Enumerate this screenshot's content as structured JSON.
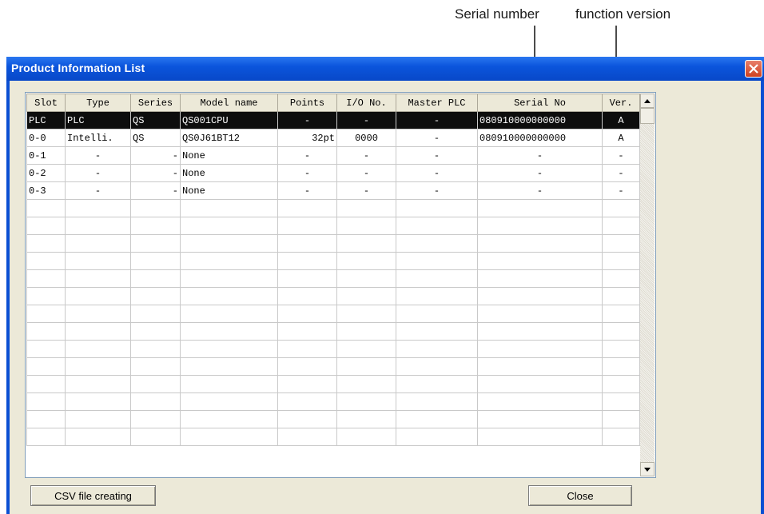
{
  "annotations": {
    "serial": "Serial number",
    "version": "function version"
  },
  "window": {
    "title": "Product Information List",
    "close_glyph": "close-icon"
  },
  "table": {
    "headers": [
      "Slot",
      "Type",
      "Series",
      "Model name",
      "Points",
      "I/O No.",
      "Master PLC",
      "Serial No",
      "Ver."
    ],
    "rows": [
      [
        "PLC",
        "PLC",
        "QS",
        "QS001CPU",
        "-",
        "-",
        "-",
        "080910000000000",
        "A"
      ],
      [
        "0-0",
        "Intelli.",
        "QS",
        "QS0J61BT12",
        "32pt",
        "0000",
        "-",
        "080910000000000",
        "A"
      ],
      [
        "0-1",
        "-",
        "-",
        "None",
        "-",
        "-",
        "-",
        "-",
        "-"
      ],
      [
        "0-2",
        "-",
        "-",
        "None",
        "-",
        "-",
        "-",
        "-",
        "-"
      ],
      [
        "0-3",
        "-",
        "-",
        "None",
        "-",
        "-",
        "-",
        "-",
        "-"
      ]
    ],
    "selected_row": 0
  },
  "buttons": {
    "csv": "CSV file creating",
    "close": "Close"
  }
}
